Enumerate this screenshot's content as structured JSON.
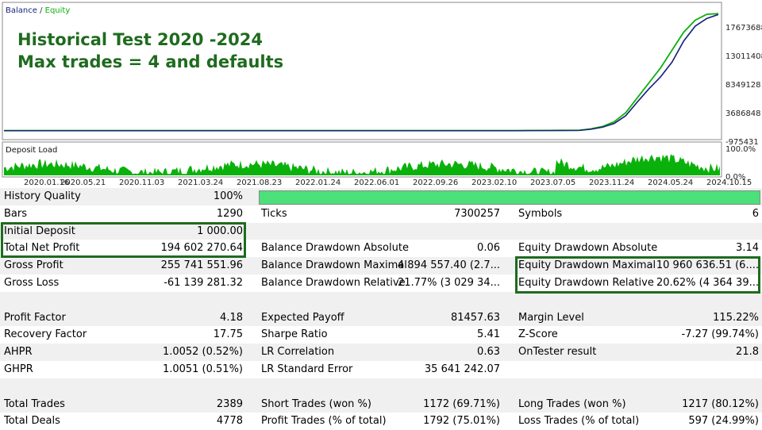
{
  "chart": {
    "legend_balance": "Balance",
    "legend_sep": " / ",
    "legend_equity": "Equity",
    "title_line1": "Historical Test 2020 -2024",
    "title_line2": "Max trades = 4 and defaults",
    "y_ticks": [
      "17673688",
      "13011408",
      "8349128",
      "3686848",
      "-975431"
    ],
    "deposit_label": "Deposit Load",
    "deposit_ticks": [
      "100.0%",
      "0.0%"
    ],
    "x_ticks": [
      "2020.01.16",
      "2020.05.21",
      "2020.11.03",
      "2021.03.24",
      "2021.08.23",
      "2022.01.24",
      "2022.06.01",
      "2022.09.26",
      "2023.02.10",
      "2023.07.05",
      "2023.11.24",
      "2024.05.24",
      "2024.10.15"
    ],
    "colors": {
      "balance": "#1a237e",
      "equity": "#0bb10b",
      "title": "#1f6b1f",
      "quality": "#4ce07a"
    }
  },
  "chart_data": {
    "type": "line",
    "series": [
      {
        "name": "Balance",
        "values": [
          1000,
          1000,
          1000,
          1000,
          1000,
          1000,
          1000,
          1000,
          1000,
          50000,
          250000,
          600000,
          1200000,
          2500000,
          4800000,
          7000000,
          9000000,
          11500000,
          15000000,
          17500000,
          18800000,
          19460000
        ]
      },
      {
        "name": "Equity",
        "values": [
          1000,
          1000,
          1000,
          1000,
          1000,
          1000,
          1000,
          1000,
          1000,
          60000,
          300000,
          700000,
          1500000,
          3000000,
          5500000,
          8000000,
          10500000,
          13500000,
          16500000,
          18500000,
          19500000,
          19600000
        ]
      }
    ],
    "x": [
      "2020.01.16",
      "2020.05.21",
      "2020.11.03",
      "2021.03.24",
      "2021.08.23",
      "2022.01.24",
      "2022.06.01",
      "2022.09.26",
      "2023.02.10",
      "2023.07.05",
      "2023.09.15",
      "2023.11.24",
      "2024.01.20",
      "2024.03.15",
      "2024.05.24",
      "2024.06.20",
      "2024.07.20",
      "2024.08.20",
      "2024.09.15",
      "2024.10.01",
      "2024.10.15",
      "2024.10.30"
    ],
    "ylim": [
      -975431,
      19500000
    ]
  },
  "stats": {
    "history_quality": {
      "label": "History Quality",
      "value": "100%"
    },
    "rows": [
      [
        "Bars",
        "1290",
        "Ticks",
        "7300257",
        "Symbols",
        "6"
      ],
      [
        "Initial Deposit",
        "1 000.00",
        "",
        "",
        "",
        ""
      ],
      [
        "Total Net Profit",
        "194 602 270.64",
        "Balance Drawdown Absolute",
        "0.06",
        "Equity Drawdown Absolute",
        "3.14"
      ],
      [
        "Gross Profit",
        "255 741 551.96",
        "Balance Drawdown Maximal",
        "4 894 557.40 (2.7...",
        "Equity Drawdown Maximal",
        "10 960 636.51 (6...."
      ],
      [
        "Gross Loss",
        "-61 139 281.32",
        "Balance Drawdown Relative",
        "21.77% (3 029 34...",
        "Equity Drawdown Relative",
        "20.62% (4 364 39..."
      ],
      [
        "",
        "",
        "",
        "",
        "",
        ""
      ],
      [
        "Profit Factor",
        "4.18",
        "Expected Payoff",
        "81457.63",
        "Margin Level",
        "115.22%"
      ],
      [
        "Recovery Factor",
        "17.75",
        "Sharpe Ratio",
        "5.41",
        "Z-Score",
        "-7.27 (99.74%)"
      ],
      [
        "AHPR",
        "1.0052 (0.52%)",
        "LR Correlation",
        "0.63",
        "OnTester result",
        "21.8"
      ],
      [
        "GHPR",
        "1.0051 (0.51%)",
        "LR Standard Error",
        "35 641 242.07",
        "",
        ""
      ],
      [
        "",
        "",
        "",
        "",
        "",
        ""
      ],
      [
        "Total Trades",
        "2389",
        "Short Trades (won %)",
        "1172 (69.71%)",
        "Long Trades (won %)",
        "1217 (80.12%)"
      ],
      [
        "Total Deals",
        "4778",
        "Profit Trades (% of total)",
        "1792 (75.01%)",
        "Loss Trades (% of total)",
        "597 (24.99%)"
      ]
    ]
  }
}
